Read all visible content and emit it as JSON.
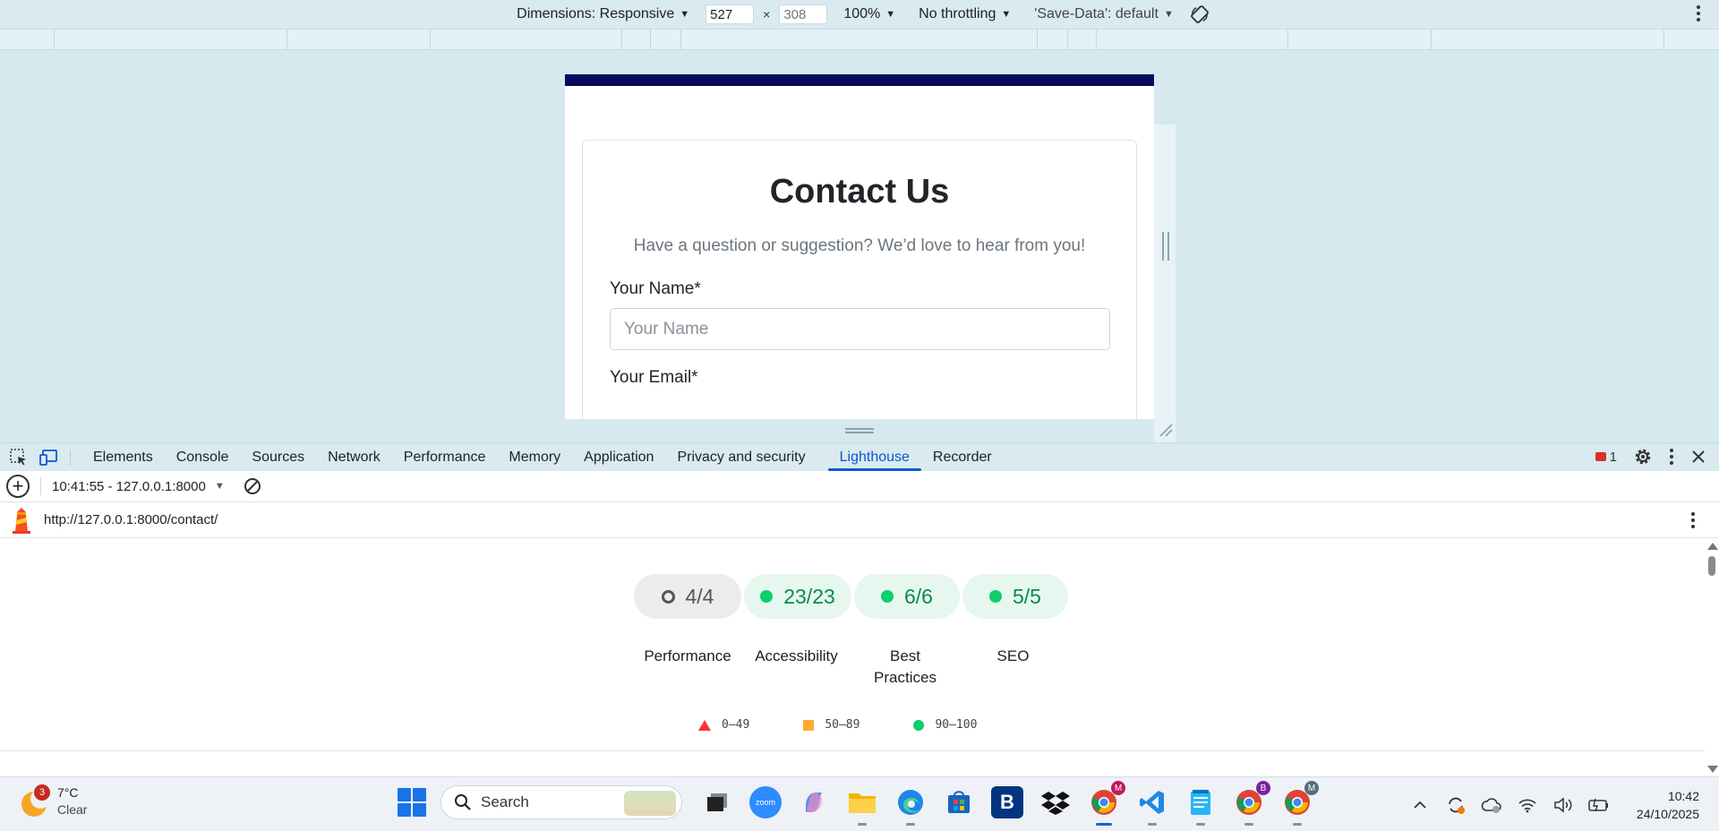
{
  "device_toolbar": {
    "dimensions_label": "Dimensions: Responsive",
    "width_value": "527",
    "height_placeholder": "308",
    "times": "×",
    "zoom": "100%",
    "throttling": "No throttling",
    "save_data": "'Save-Data': default"
  },
  "page": {
    "title": "Contact Us",
    "subtitle": "Have a question or suggestion? We’d love to hear from you!",
    "name_label": "Your Name*",
    "name_placeholder": "Your Name",
    "email_label": "Your Email*"
  },
  "devtools": {
    "tabs": [
      "Elements",
      "Console",
      "Sources",
      "Network",
      "Performance",
      "Memory",
      "Application",
      "Privacy and security",
      "Lighthouse",
      "Recorder"
    ],
    "active_tab": "Lighthouse",
    "error_count": "1"
  },
  "lighthouse": {
    "report_select": "10:41:55 - 127.0.0.1:8000",
    "url": "http://127.0.0.1:8000/contact/",
    "gauges": [
      {
        "score": "4/4",
        "label": "Performance",
        "status": "neutral"
      },
      {
        "score": "23/23",
        "label": "Accessibility",
        "status": "pass"
      },
      {
        "score": "6/6",
        "label": "Best Practices",
        "status": "pass"
      },
      {
        "score": "5/5",
        "label": "SEO",
        "status": "pass"
      }
    ],
    "legend": [
      {
        "range": "0–49",
        "shape": "triangle",
        "color": "#ff3333"
      },
      {
        "range": "50–89",
        "shape": "square",
        "color": "#ffaa33"
      },
      {
        "range": "90–100",
        "shape": "circle",
        "color": "#0cce6b"
      }
    ]
  },
  "taskbar": {
    "weather_badge": "3",
    "temperature": "7°C",
    "condition": "Clear",
    "search_label": "Search",
    "zoom_app": "zoom",
    "chrome_badge_1": "M",
    "chrome_badge_2": "B",
    "chrome_badge_3": "M",
    "time": "10:42",
    "date": "24/10/2025"
  },
  "colors": {
    "accent": "#0b57d0",
    "page_header": "#050a5c",
    "pass_green": "#0cce6b"
  }
}
